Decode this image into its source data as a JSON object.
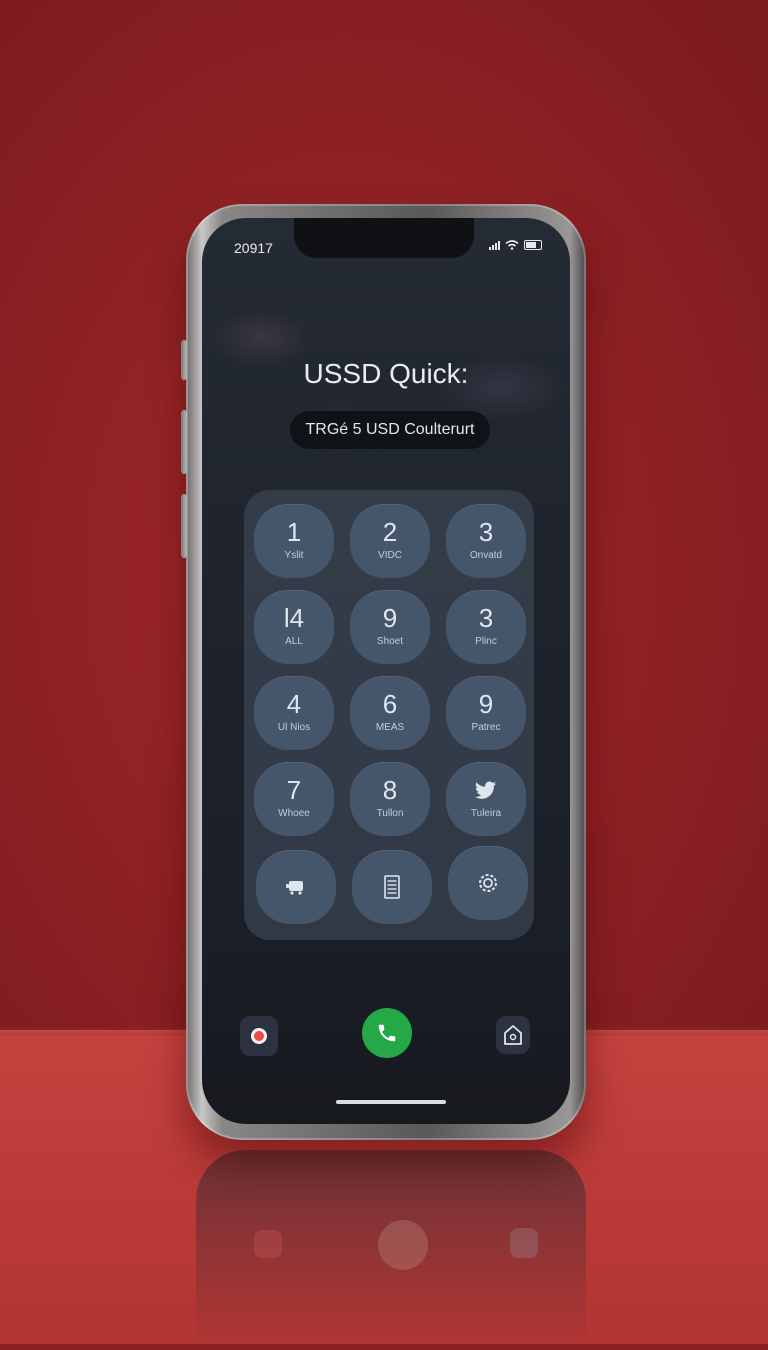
{
  "status_bar": {
    "time": "20917"
  },
  "screen": {
    "title": "USSD Quick:",
    "code_display": "TRGé 5 USD Coulterurt"
  },
  "keypad": {
    "keys": [
      {
        "digit": "1",
        "sub": "Yslit"
      },
      {
        "digit": "2",
        "sub": "VIDC"
      },
      {
        "digit": "3",
        "sub": "Onvatd"
      },
      {
        "digit": "l4",
        "sub": "ALL"
      },
      {
        "digit": "9",
        "sub": "Shoet"
      },
      {
        "digit": "3",
        "sub": "Plinc"
      },
      {
        "digit": "4",
        "sub": "Ul Nios"
      },
      {
        "digit": "6",
        "sub": "MEAS"
      },
      {
        "digit": "9",
        "sub": "Patrec"
      },
      {
        "digit": "7",
        "sub": "Whoee"
      },
      {
        "digit": "8",
        "sub": "Tullon"
      },
      {
        "icon": "bird-icon",
        "sub": "Tuleira"
      },
      {
        "icon": "bus-icon"
      },
      {
        "icon": "list-icon"
      },
      {
        "icon": "gear-icon"
      }
    ]
  },
  "bottom_actions": {
    "record_icon": "record-icon",
    "call_icon": "phone-icon",
    "home_icon": "home-icon"
  },
  "colors": {
    "background": "#9b2527",
    "call_button": "#25a948",
    "record_dot": "#ea4b47",
    "key_fill": "#46566a"
  }
}
